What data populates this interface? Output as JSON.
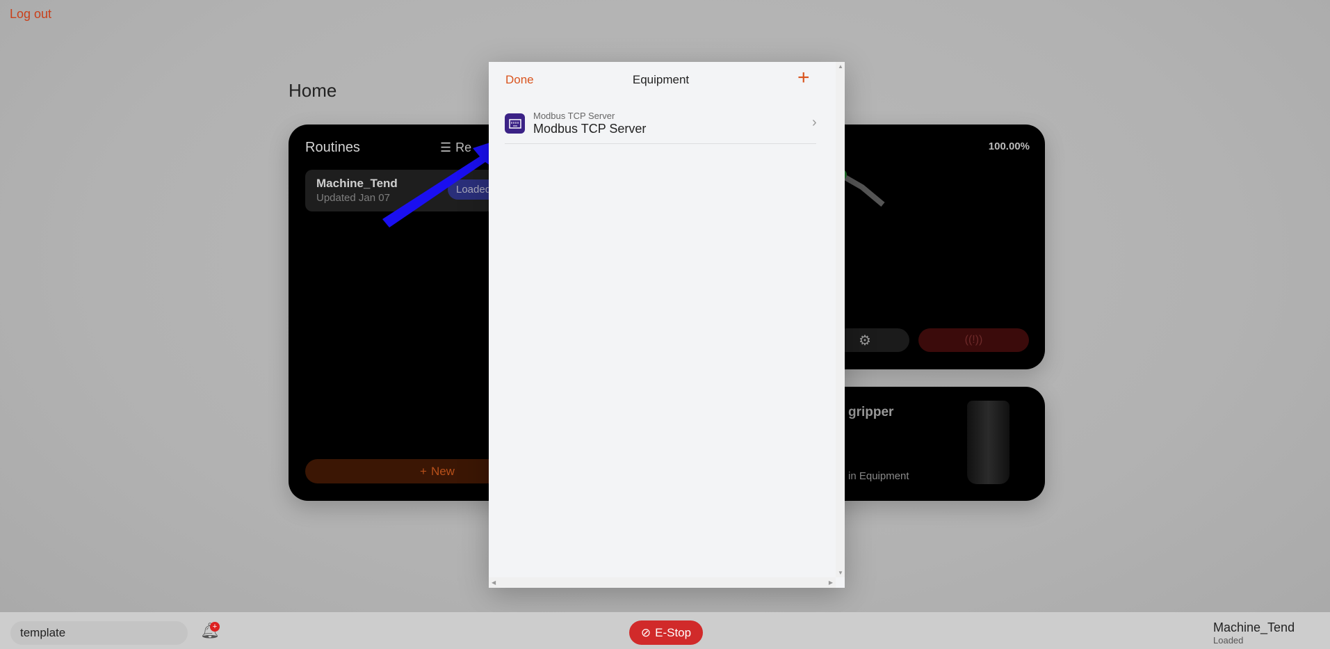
{
  "header": {
    "logout": "Log out",
    "title": "Home"
  },
  "routines": {
    "title": "Routines",
    "filter_label": "Re",
    "item": {
      "name": "Machine_Tend",
      "updated": "Updated Jan 07",
      "badge": "Loaded"
    },
    "new_label": "New"
  },
  "robot": {
    "speed": "100.00%"
  },
  "gripper": {
    "title": "gripper",
    "subtitle": "in Equipment"
  },
  "modal": {
    "done": "Done",
    "title": "Equipment",
    "add": "+",
    "items": [
      {
        "type": "Modbus TCP Server",
        "name": "Modbus TCP Server"
      }
    ]
  },
  "footer": {
    "template_value": "template",
    "notification_badge": "+",
    "estop": "E-Stop",
    "routine_name": "Machine_Tend",
    "routine_status": "Loaded"
  },
  "colors": {
    "accent": "#d9541e",
    "estop": "#d12a2a",
    "annotation_arrow": "#1a0ff0"
  }
}
